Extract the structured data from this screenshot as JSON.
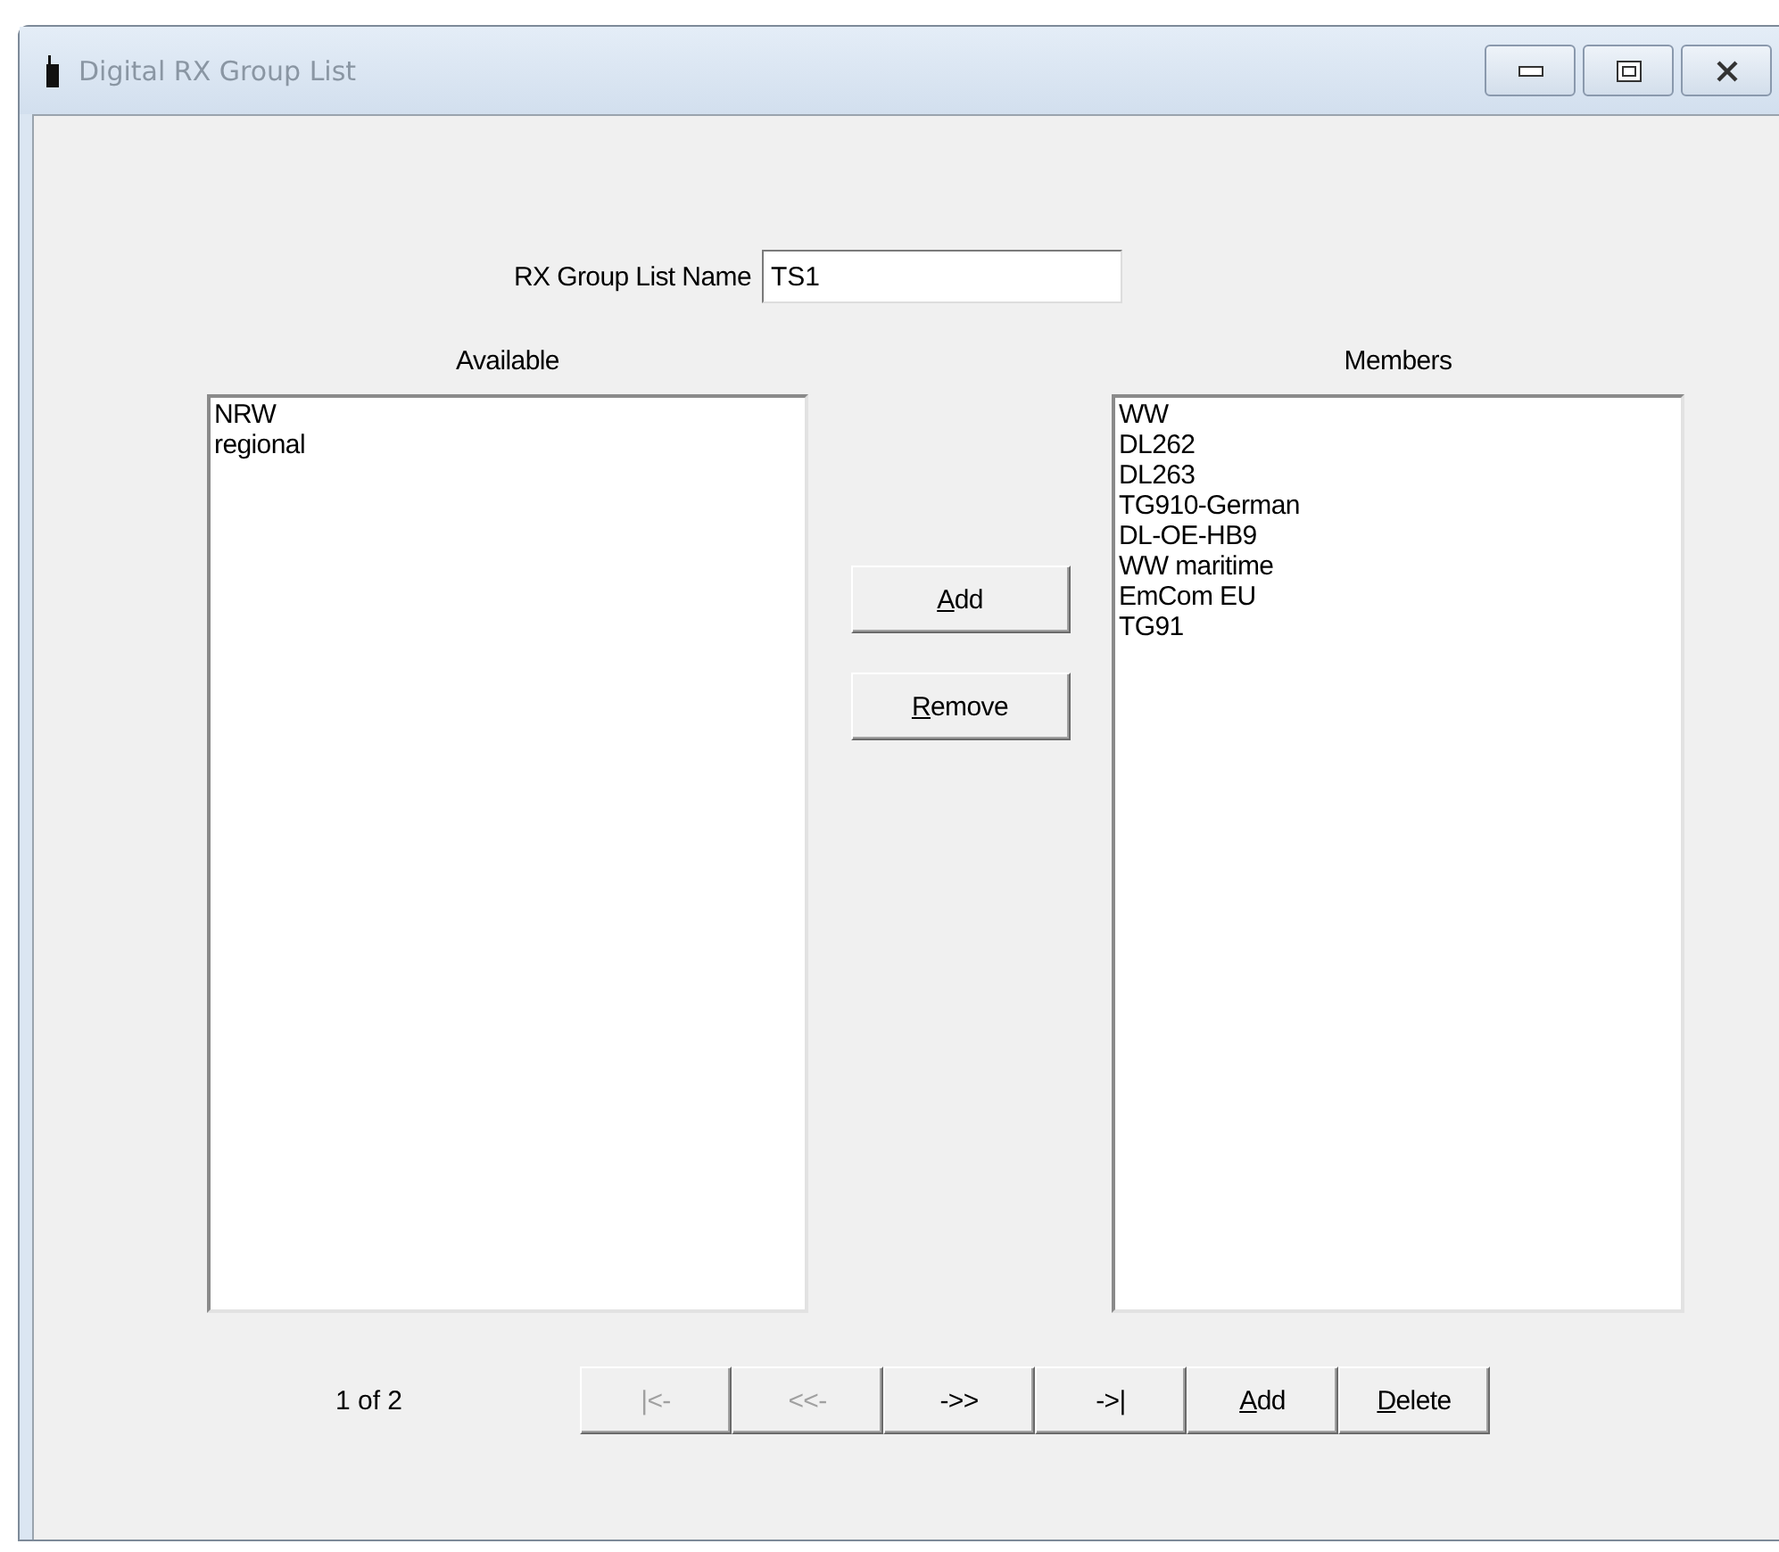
{
  "window": {
    "title": "Digital RX Group List"
  },
  "name_field": {
    "label": "RX Group List Name",
    "value": "TS1"
  },
  "available": {
    "label": "Available",
    "items": [
      "NRW",
      "regional"
    ]
  },
  "members": {
    "label": "Members",
    "items": [
      "WW",
      "DL262",
      "DL263",
      "TG910-German",
      "DL-OE-HB9",
      "WW maritime",
      "EmCom EU",
      "TG91"
    ]
  },
  "transfer_buttons": [
    {
      "accel": "A",
      "rest": "dd"
    },
    {
      "accel": "R",
      "rest": "emove"
    }
  ],
  "pager": {
    "position": "1 of 2",
    "buttons": [
      {
        "rest": "|<-",
        "disabled": true
      },
      {
        "rest": "<<-",
        "disabled": true
      },
      {
        "rest": "->>",
        "disabled": false
      },
      {
        "rest": "->|",
        "disabled": false
      },
      {
        "accel": "A",
        "rest": "dd",
        "disabled": false
      },
      {
        "accel": "D",
        "rest": "elete",
        "disabled": false
      }
    ]
  }
}
